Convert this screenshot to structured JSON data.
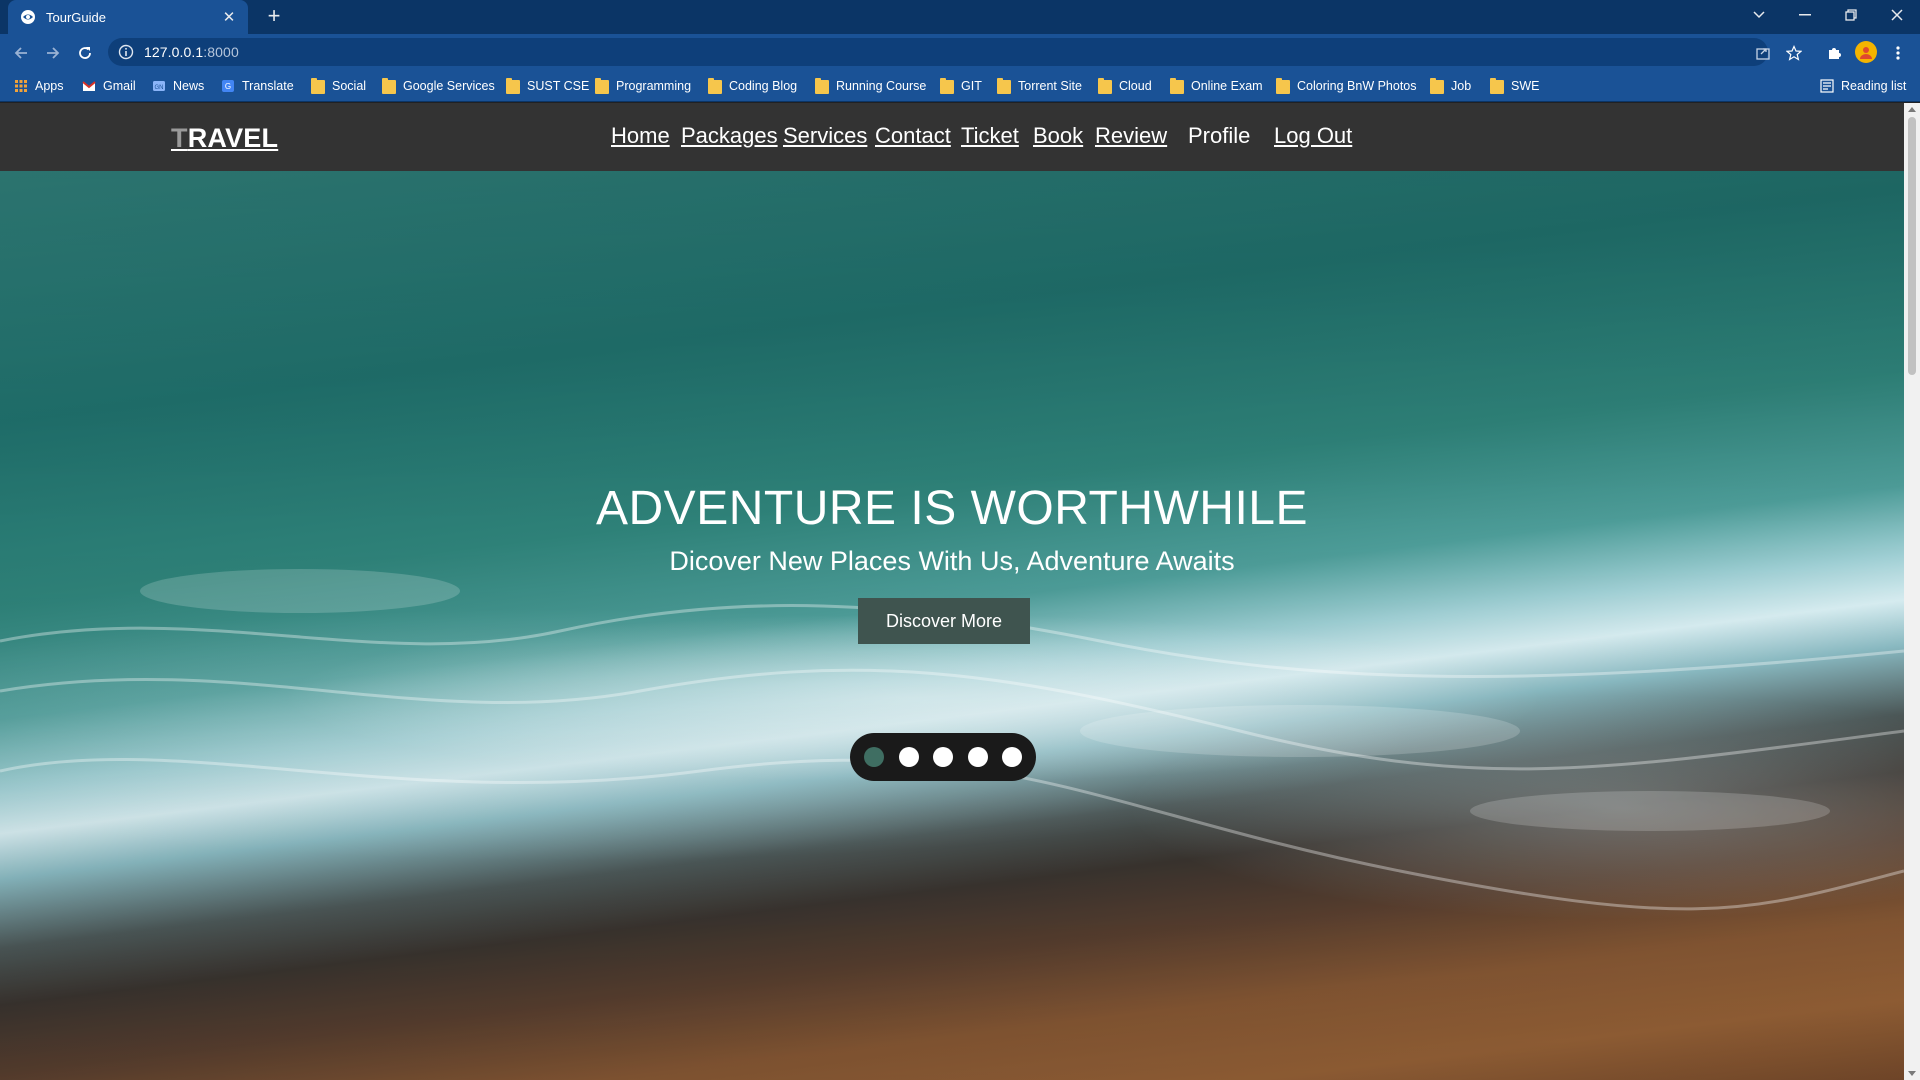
{
  "browser": {
    "tab_title": "TourGuide",
    "url_host": "127.0.0.1",
    "url_port": ":8000",
    "new_tab_symbol": "+",
    "close_symbol": "✕",
    "bookmarks": [
      {
        "label": "Apps",
        "icon": "apps-grid-icon"
      },
      {
        "label": "Gmail",
        "icon": "gmail-icon"
      },
      {
        "label": "News",
        "icon": "news-icon"
      },
      {
        "label": "Translate",
        "icon": "translate-icon"
      },
      {
        "label": "Social",
        "icon": "folder-icon"
      },
      {
        "label": "Google Services",
        "icon": "folder-icon"
      },
      {
        "label": "SUST CSE",
        "icon": "folder-icon"
      },
      {
        "label": "Programming",
        "icon": "folder-icon"
      },
      {
        "label": "Coding Blog",
        "icon": "folder-icon"
      },
      {
        "label": "Running Course",
        "icon": "folder-icon"
      },
      {
        "label": "GIT",
        "icon": "folder-icon"
      },
      {
        "label": "Torrent Site",
        "icon": "folder-icon"
      },
      {
        "label": "Cloud",
        "icon": "folder-icon"
      },
      {
        "label": "Online Exam",
        "icon": "folder-icon"
      },
      {
        "label": "Coloring BnW Photos",
        "icon": "folder-icon"
      },
      {
        "label": "Job",
        "icon": "folder-icon"
      },
      {
        "label": "SWE",
        "icon": "folder-icon"
      }
    ],
    "reading_list": "Reading list",
    "colors": {
      "tabstrip": "#0b3566",
      "toolbar": "#1a5296",
      "folder": "#f6c64c"
    }
  },
  "site": {
    "logo_first": "T",
    "logo_rest": "RAVEL",
    "menu": [
      "Home",
      "Packages",
      "Services",
      "Contact",
      "Ticket",
      "Book",
      "Review",
      "Profile",
      "Log Out"
    ],
    "hero": {
      "title": "ADVENTURE IS WORTHWHILE",
      "subtitle": "Dicover New Places With Us, Adventure Awaits",
      "button": "Discover More",
      "slides_total": 5,
      "active_slide": 1
    },
    "colors": {
      "nav_bg": "#333333",
      "button_bg": "#3f544f",
      "active_dot": "#3f6e62"
    }
  }
}
